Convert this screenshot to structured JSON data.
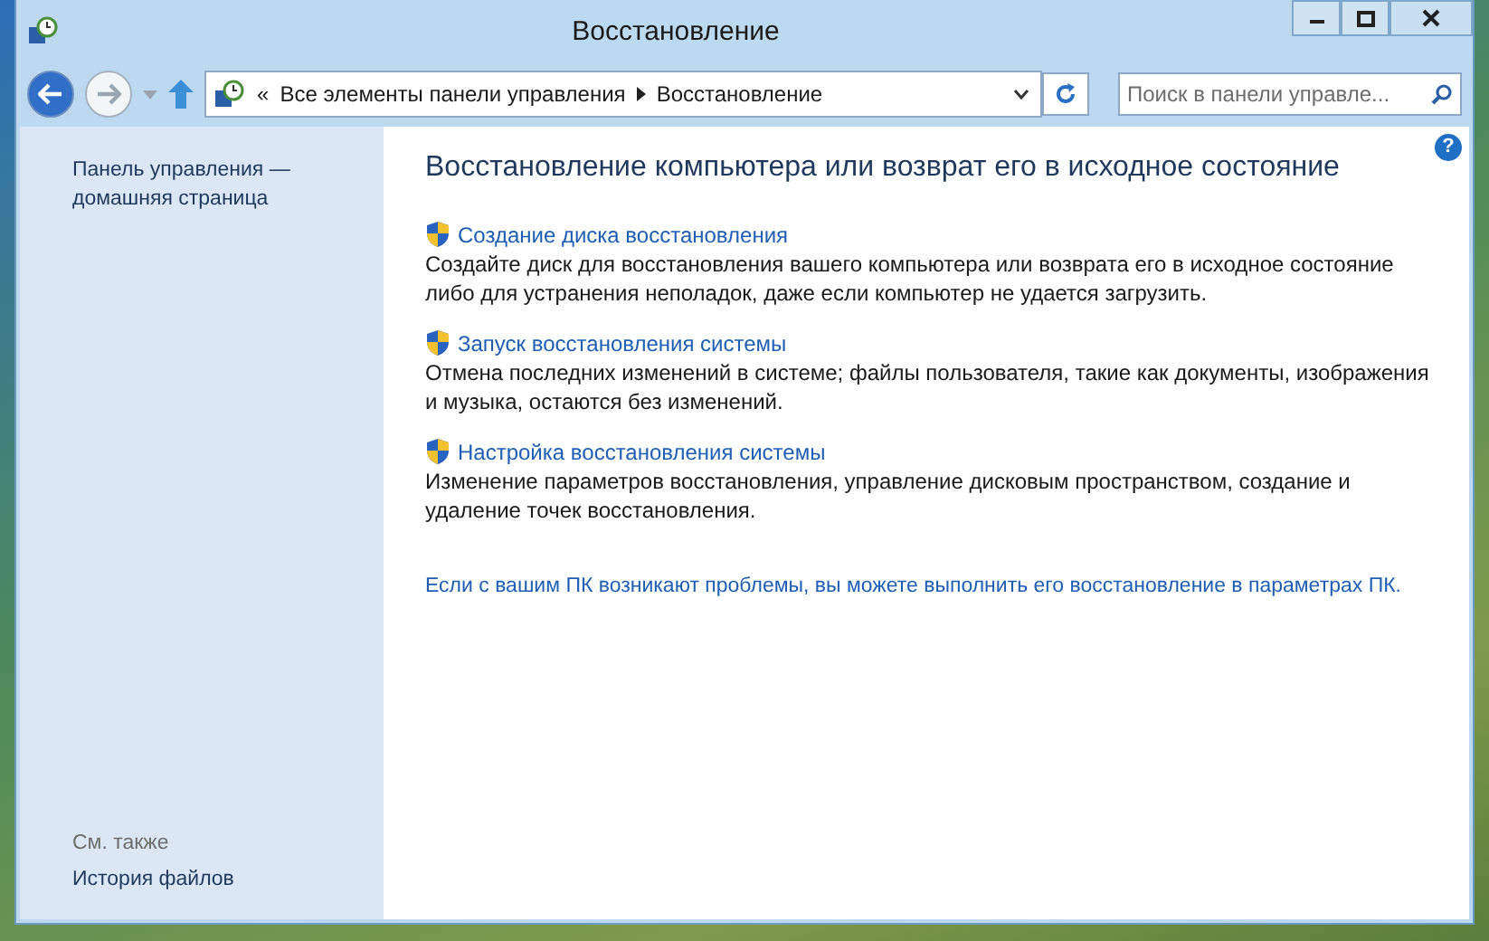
{
  "window": {
    "title": "Восстановление"
  },
  "navigation": {
    "back_disabled": false,
    "forward_disabled": true
  },
  "address_bar": {
    "prefix": "«",
    "crumbs": [
      "Все элементы панели управления",
      "Восстановление"
    ]
  },
  "search": {
    "placeholder": "Поиск в панели управле..."
  },
  "help": {
    "label": "?"
  },
  "sidebar": {
    "home_link": "Панель управления — домашняя страница",
    "see_also_heading": "См. также",
    "see_also_items": [
      "История файлов"
    ]
  },
  "content": {
    "heading": "Восстановление компьютера или возврат его в исходное состояние",
    "tasks": [
      {
        "title": "Создание диска восстановления",
        "description": "Создайте диск для восстановления вашего компьютера или возврата его в исходное состояние либо для устранения неполадок, даже если компьютер не удается загрузить."
      },
      {
        "title": "Запуск восстановления системы",
        "description": "Отмена последних изменений в системе; файлы пользователя, такие как документы, изображения и музыка, остаются без изменений."
      },
      {
        "title": "Настройка восстановления системы",
        "description": "Изменение параметров восстановления, управление дисковым пространством, создание и удаление точек восстановления."
      }
    ],
    "footer_link": "Если с вашим ПК возникают проблемы, вы можете выполнить его восстановление в параметрах ПК."
  }
}
